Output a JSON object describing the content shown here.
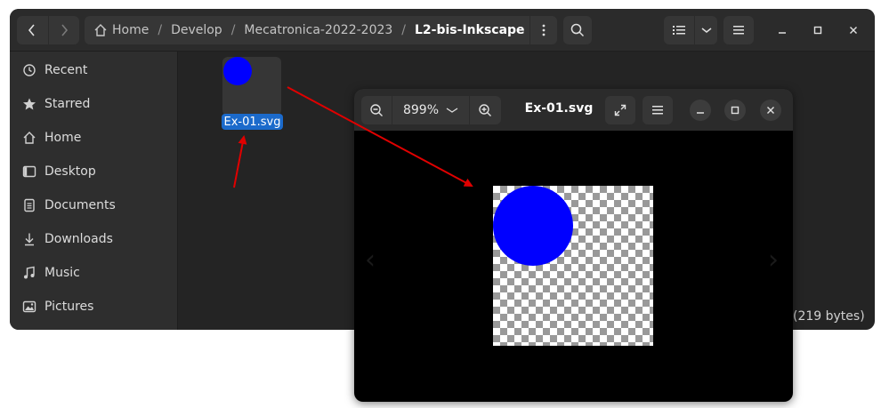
{
  "files_window": {
    "path": [
      "Home",
      "Develop",
      "Mecatronica-2022-2023",
      "L2-bis-Inkscape"
    ],
    "sidebar": [
      {
        "label": "Recent",
        "icon": "clock-icon"
      },
      {
        "label": "Starred",
        "icon": "star-icon"
      },
      {
        "label": "Home",
        "icon": "home-icon"
      },
      {
        "label": "Desktop",
        "icon": "desktop-icon"
      },
      {
        "label": "Documents",
        "icon": "document-icon"
      },
      {
        "label": "Downloads",
        "icon": "download-icon"
      },
      {
        "label": "Music",
        "icon": "music-icon"
      },
      {
        "label": "Pictures",
        "icon": "picture-icon"
      }
    ],
    "file": {
      "name": "Ex-01.svg"
    },
    "status": "(219 bytes)"
  },
  "viewer": {
    "zoom": "899%",
    "title": "Ex-01.svg"
  },
  "colors": {
    "accent": "#1b6acb",
    "circle": "#0000ff",
    "arrow": "#e00000"
  }
}
